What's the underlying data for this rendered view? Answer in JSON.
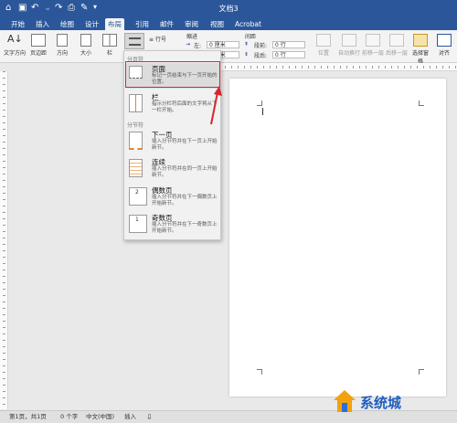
{
  "titlebar": {
    "title": "文档3"
  },
  "tabs": [
    "开始",
    "插入",
    "绘图",
    "设计",
    "布局",
    "引用",
    "邮件",
    "审阅",
    "视图",
    "Acrobat"
  ],
  "ribbon": {
    "text_direction": "文字方向",
    "margins": "页边距",
    "orientation": "方向",
    "size": "大小",
    "columns": "栏",
    "line_numbers": "行号",
    "indent_label": "缩进",
    "spacing_label": "间距",
    "left_label": "左:",
    "left_value": "0 厘米",
    "right_value": "0 厘米",
    "before_label": "段前:",
    "before_value": "0 行",
    "after_label": "段后:",
    "after_value": "0 行",
    "position": "位置",
    "wrap_text": "自动换行",
    "bring_forward": "前移一层",
    "send_backward": "后移一层",
    "selection_pane": "选择窗格",
    "align": "对齐"
  },
  "breaks_menu": {
    "page_breaks_header": "分页符",
    "section_breaks_header": "分节符",
    "items": [
      {
        "title": "页面",
        "desc": "标记一页结束与下一页开始的位置。"
      },
      {
        "title": "栏",
        "desc": "指示分栏符后面的文字将从下一栏开始。"
      },
      {
        "title": "下一页",
        "desc": "插入分节符并在下一页上开始新节。"
      },
      {
        "title": "连续",
        "desc": "插入分节符并在同一页上开始新节。"
      },
      {
        "title": "偶数页",
        "desc": "插入分节符并在下一偶数页上开始新节。",
        "badge": "2"
      },
      {
        "title": "奇数页",
        "desc": "插入分节符并在下一奇数页上开始新节。",
        "badge": "1"
      }
    ]
  },
  "statusbar": {
    "page": "第1页，共1页",
    "words": "0 个字",
    "language": "中文(中国)",
    "mode": "插入"
  },
  "watermark": {
    "text": "系统城"
  },
  "colors": {
    "accent": "#2b579a",
    "highlight": "#d9252f"
  }
}
